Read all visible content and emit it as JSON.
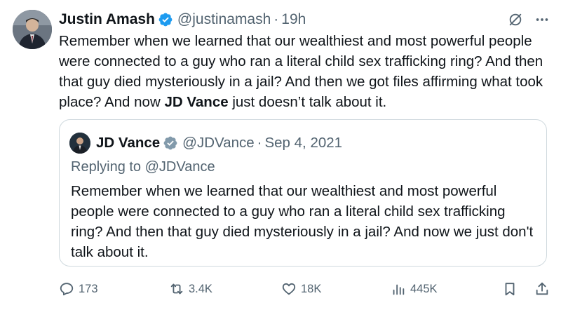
{
  "tweet": {
    "author_name": "Justin Amash",
    "author_handle": "@justinamash",
    "separator": "·",
    "time": "19h",
    "text_before_mention": "Remember when we learned that our wealthiest and most powerful people were connected to a guy who ran a literal child sex trafficking ring? And then that guy died mysteriously in a jail? And then we got files affirming what took place? And now ",
    "text_mention": "JD Vance",
    "text_after_mention": " just doesn’t talk about it.",
    "icons": {
      "verified": "verified-badge-icon",
      "grok": "grok-icon",
      "more": "more-icon"
    }
  },
  "quote": {
    "author_name": "JD Vance",
    "author_handle": "@JDVance",
    "separator": "·",
    "date": "Sep 4, 2021",
    "replying_prefix": "Replying to",
    "replying_handle": "@JDVance",
    "text": "Remember when we learned that our wealthiest and most powerful people were connected to a guy who ran a literal child sex trafficking ring? And then that guy died mysteriously in a jail? And now we just don't talk about it."
  },
  "actions": {
    "replies": "173",
    "reposts": "3.4K",
    "likes": "18K",
    "views": "445K"
  },
  "colors": {
    "text_primary": "#0f1419",
    "text_secondary": "#536471",
    "verified_blue": "#1d9bf0",
    "quote_verified_gray": "#829aab",
    "border": "#cfd9de"
  }
}
